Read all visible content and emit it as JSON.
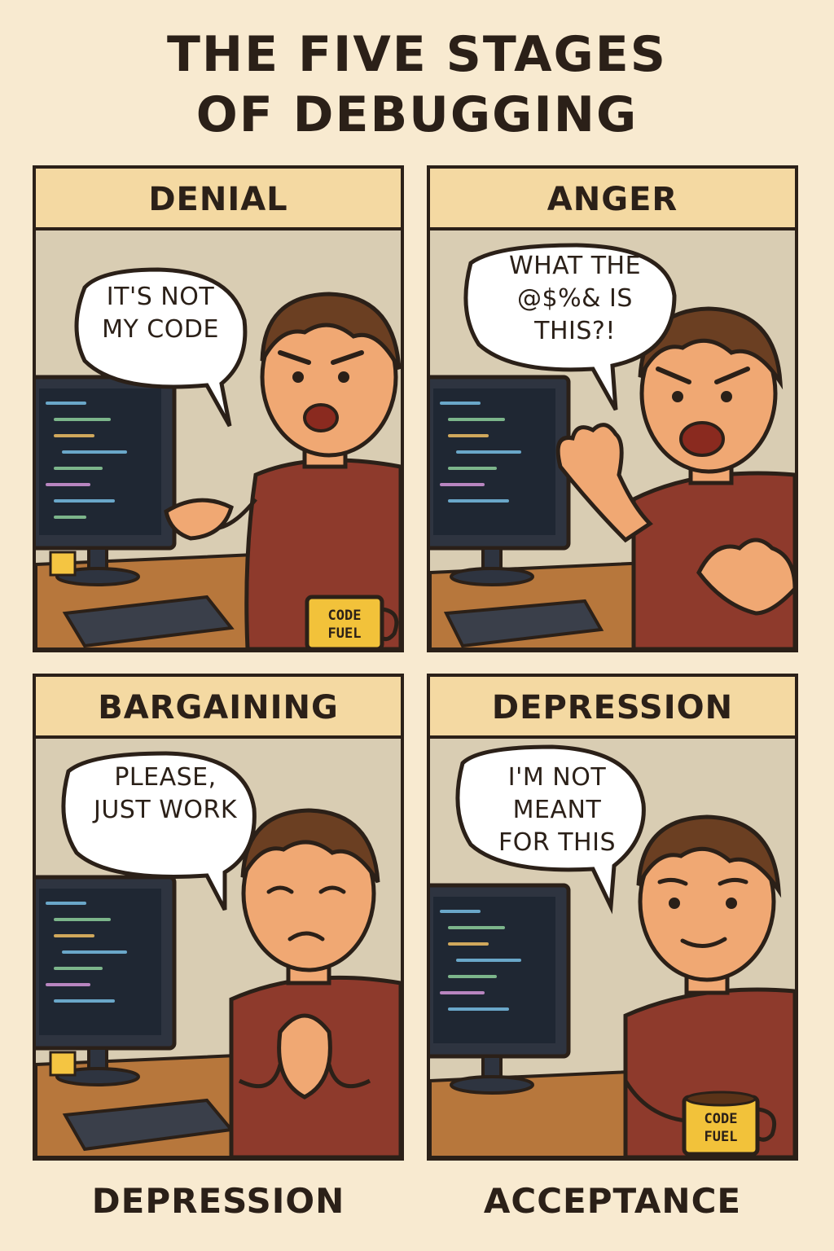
{
  "title": {
    "line1": "THE FIVE STAGES",
    "line2": "OF DEBUGGING"
  },
  "panels": [
    {
      "heading": "DENIAL",
      "speech": [
        "IT'S NOT",
        "MY CODE"
      ],
      "mood": "annoyed",
      "mug": "CODE FUEL"
    },
    {
      "heading": "ANGER",
      "speech": [
        "WHAT THE",
        "@$%& IS",
        "THIS?!"
      ],
      "mood": "angry",
      "mug": ""
    },
    {
      "heading": "BARGAINING",
      "speech": [
        "PLEASE,",
        "JUST WORK"
      ],
      "mood": "praying",
      "mug": ""
    },
    {
      "heading": "DEPRESSION",
      "speech": [
        "I'M NOT",
        "MEANT",
        "FOR THIS"
      ],
      "mood": "resigned",
      "mug": "CODE FUEL"
    }
  ],
  "captions": {
    "left": "DEPRESSION",
    "right": "ACCEPTANCE"
  },
  "mug": {
    "line1": "CODE",
    "line2": "FUEL"
  },
  "colors": {
    "background": "#f8ead0",
    "header": "#f4d9a2",
    "ink": "#2b2018",
    "shirt": "#8e3a2c",
    "skin": "#f0a873",
    "hair": "#6b3f22",
    "desk": "#b7773c",
    "monitor": "#2e3440",
    "mug": "#f2c23a"
  }
}
